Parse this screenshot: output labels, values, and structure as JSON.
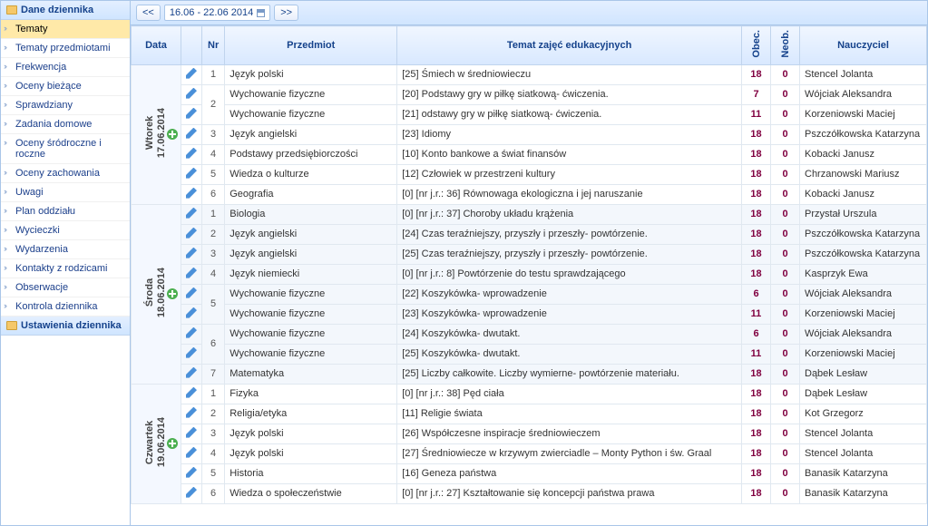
{
  "sidebar": {
    "sections": [
      {
        "title": "Dane dziennika",
        "items": [
          "Tematy",
          "Tematy przedmiotami",
          "Frekwencja",
          "Oceny bieżące",
          "Sprawdziany",
          "Zadania domowe",
          "Oceny śródroczne i roczne",
          "Oceny zachowania",
          "Uwagi",
          "Plan oddziału",
          "Wycieczki",
          "Wydarzenia",
          "Kontakty z rodzicami",
          "Obserwacje",
          "Kontrola dziennika"
        ],
        "active": 0
      },
      {
        "title": "Ustawienia dziennika",
        "items": []
      }
    ]
  },
  "toolbar": {
    "prev": "<<",
    "next": ">>",
    "range": "16.06 - 22.06 2014"
  },
  "headers": {
    "data": "Data",
    "nr": "Nr",
    "przedmiot": "Przedmiot",
    "temat": "Temat zajęć edukacyjnych",
    "obec": "Obec.",
    "neob": "Neob.",
    "nauczyciel": "Nauczyciel"
  },
  "days": [
    {
      "label": "Wtorek\n17.06.2014",
      "rows": [
        {
          "nr": "1",
          "subj": "Język polski",
          "topic": "[25] Śmiech w średniowieczu",
          "obec": "18",
          "neob": "0",
          "teach": "Stencel Jolanta",
          "rs": 1
        },
        {
          "nr": "2",
          "subj": "Wychowanie fizyczne",
          "topic": "[20] Podstawy gry w piłkę siatkową- ćwiczenia.",
          "obec": "7",
          "neob": "0",
          "teach": "Wójciak Aleksandra",
          "rs": 2
        },
        {
          "nr": "",
          "subj": "Wychowanie fizyczne",
          "topic": "[21] odstawy gry w piłkę siatkową- ćwiczenia.",
          "obec": "11",
          "neob": "0",
          "teach": "Korzeniowski Maciej",
          "rs": 0
        },
        {
          "nr": "3",
          "subj": "Język angielski",
          "topic": "[23] Idiomy",
          "obec": "18",
          "neob": "0",
          "teach": "Pszczółkowska Katarzyna",
          "rs": 1
        },
        {
          "nr": "4",
          "subj": "Podstawy przedsiębiorczości",
          "topic": "[10] Konto bankowe a świat finansów",
          "obec": "18",
          "neob": "0",
          "teach": "Kobacki Janusz",
          "rs": 1
        },
        {
          "nr": "5",
          "subj": "Wiedza o kulturze",
          "topic": "[12] Człowiek w przestrzeni kultury",
          "obec": "18",
          "neob": "0",
          "teach": "Chrzanowski Mariusz",
          "rs": 1
        },
        {
          "nr": "6",
          "subj": "Geografia",
          "topic": "[0] [nr j.r.: 36] Równowaga ekologiczna i jej naruszanie",
          "obec": "18",
          "neob": "0",
          "teach": "Kobacki Janusz",
          "rs": 1
        }
      ]
    },
    {
      "label": "Środa\n18.06.2014",
      "alt": true,
      "rows": [
        {
          "nr": "1",
          "subj": "Biologia",
          "topic": "[0] [nr j.r.: 37] Choroby układu krążenia",
          "obec": "18",
          "neob": "0",
          "teach": "Przystał Urszula",
          "rs": 1
        },
        {
          "nr": "2",
          "subj": "Język angielski",
          "topic": "[24] Czas teraźniejszy, przyszły i przeszły- powtórzenie.",
          "obec": "18",
          "neob": "0",
          "teach": "Pszczółkowska Katarzyna",
          "rs": 1
        },
        {
          "nr": "3",
          "subj": "Język angielski",
          "topic": "[25] Czas teraźniejszy, przyszły i przeszły- powtórzenie.",
          "obec": "18",
          "neob": "0",
          "teach": "Pszczółkowska Katarzyna",
          "rs": 1
        },
        {
          "nr": "4",
          "subj": "Język niemiecki",
          "topic": "[0] [nr j.r.: 8] Powtórzenie do testu sprawdzającego",
          "obec": "18",
          "neob": "0",
          "teach": "Kasprzyk Ewa",
          "rs": 1
        },
        {
          "nr": "5",
          "subj": "Wychowanie fizyczne",
          "topic": "[22] Koszykówka- wprowadzenie",
          "obec": "6",
          "neob": "0",
          "teach": "Wójciak Aleksandra",
          "rs": 2
        },
        {
          "nr": "",
          "subj": "Wychowanie fizyczne",
          "topic": "[23] Koszykówka- wprowadzenie",
          "obec": "11",
          "neob": "0",
          "teach": "Korzeniowski Maciej",
          "rs": 0
        },
        {
          "nr": "6",
          "subj": "Wychowanie fizyczne",
          "topic": "[24] Koszykówka- dwutakt.",
          "obec": "6",
          "neob": "0",
          "teach": "Wójciak Aleksandra",
          "rs": 2
        },
        {
          "nr": "",
          "subj": "Wychowanie fizyczne",
          "topic": "[25] Koszykówka- dwutakt.",
          "obec": "11",
          "neob": "0",
          "teach": "Korzeniowski Maciej",
          "rs": 0
        },
        {
          "nr": "7",
          "subj": "Matematyka",
          "topic": "[25] Liczby całkowite. Liczby wymierne- powtórzenie materiału.",
          "obec": "18",
          "neob": "0",
          "teach": "Dąbek Lesław",
          "rs": 1
        }
      ]
    },
    {
      "label": "Czwartek\n19.06.2014",
      "rows": [
        {
          "nr": "1",
          "subj": "Fizyka",
          "topic": "[0] [nr j.r.: 38] Pęd ciała",
          "obec": "18",
          "neob": "0",
          "teach": "Dąbek Lesław",
          "rs": 1
        },
        {
          "nr": "2",
          "subj": "Religia/etyka",
          "topic": "[11] Religie świata",
          "obec": "18",
          "neob": "0",
          "teach": "Kot Grzegorz",
          "rs": 1
        },
        {
          "nr": "3",
          "subj": "Język polski",
          "topic": "[26] Współczesne inspiracje średniowieczem",
          "obec": "18",
          "neob": "0",
          "teach": "Stencel Jolanta",
          "rs": 1
        },
        {
          "nr": "4",
          "subj": "Język polski",
          "topic": "[27] Średniowiecze w krzywym zwierciadle – Monty Python i św. Graal",
          "obec": "18",
          "neob": "0",
          "teach": "Stencel Jolanta",
          "rs": 1
        },
        {
          "nr": "5",
          "subj": "Historia",
          "topic": "[16] Geneza państwa",
          "obec": "18",
          "neob": "0",
          "teach": "Banasik Katarzyna",
          "rs": 1
        },
        {
          "nr": "6",
          "subj": "Wiedza o społeczeństwie",
          "topic": "[0] [nr j.r.: 27] Kształtowanie się koncepcji państwa prawa",
          "obec": "18",
          "neob": "0",
          "teach": "Banasik Katarzyna",
          "rs": 1
        }
      ]
    }
  ]
}
